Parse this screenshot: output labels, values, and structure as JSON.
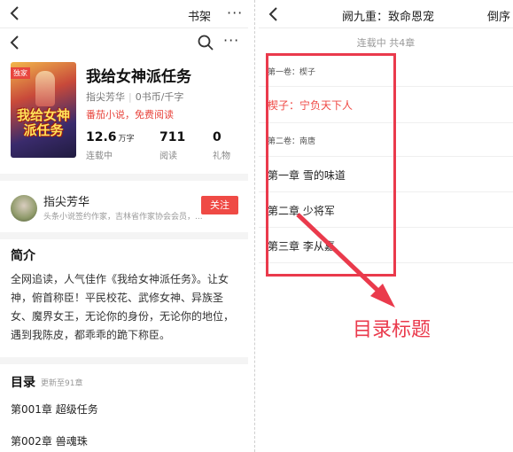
{
  "left": {
    "topbar": {
      "shelf_label": "书架",
      "more_label": "···"
    },
    "navbar": {
      "more_label": "···"
    },
    "book": {
      "cover_tag": "独家",
      "cover_title": "我给女神派任务",
      "title": "我给女神派任务",
      "author": "指尖芳华",
      "price": "0书币/千字",
      "free_text": "番茄小说，免费阅读"
    },
    "stats": [
      {
        "num": "12.6",
        "unit": "万字",
        "label": "连载中"
      },
      {
        "num": "711",
        "unit": "",
        "label": "阅读"
      },
      {
        "num": "0",
        "unit": "",
        "label": "礼物"
      }
    ],
    "author_card": {
      "name": "指尖芳华",
      "desc": "头条小说签约作家，吉林省作家协会会员，...",
      "follow_label": "关注"
    },
    "intro": {
      "heading": "简介",
      "text": "全网追读，人气佳作《我给女神派任务》。让女神，俯首称臣！平民校花、武修女神、异族圣女、魔界女王，无论你的身份，无论你的地位，遇到我陈皮，都乖乖的跪下称臣。"
    },
    "toc": {
      "heading": "目录",
      "updated": "更新至91章",
      "items": [
        "第001章 超级任务",
        "第002章 兽魂珠"
      ]
    }
  },
  "right": {
    "header": {
      "title": "阙九重：致命恩宠",
      "order_label": "倒序"
    },
    "status": "连载中 共4章",
    "rows": [
      {
        "kind": "vol",
        "text": "第一卷：楔子"
      },
      {
        "kind": "chapter",
        "text": "楔子：宁负天下人",
        "active": true
      },
      {
        "kind": "vol",
        "text": "第二卷：南唐"
      },
      {
        "kind": "chapter",
        "text": "第一章 雪的味道"
      },
      {
        "kind": "chapter",
        "text": "第二章 少将军"
      },
      {
        "kind": "chapter",
        "text": "第三章 李从嘉"
      }
    ],
    "annotation": "目录标题"
  },
  "colors": {
    "accent": "#ef4a45",
    "annotation": "#ea3a4c"
  },
  "icons": [
    "back-arrow-icon",
    "search-icon",
    "more-icon"
  ]
}
